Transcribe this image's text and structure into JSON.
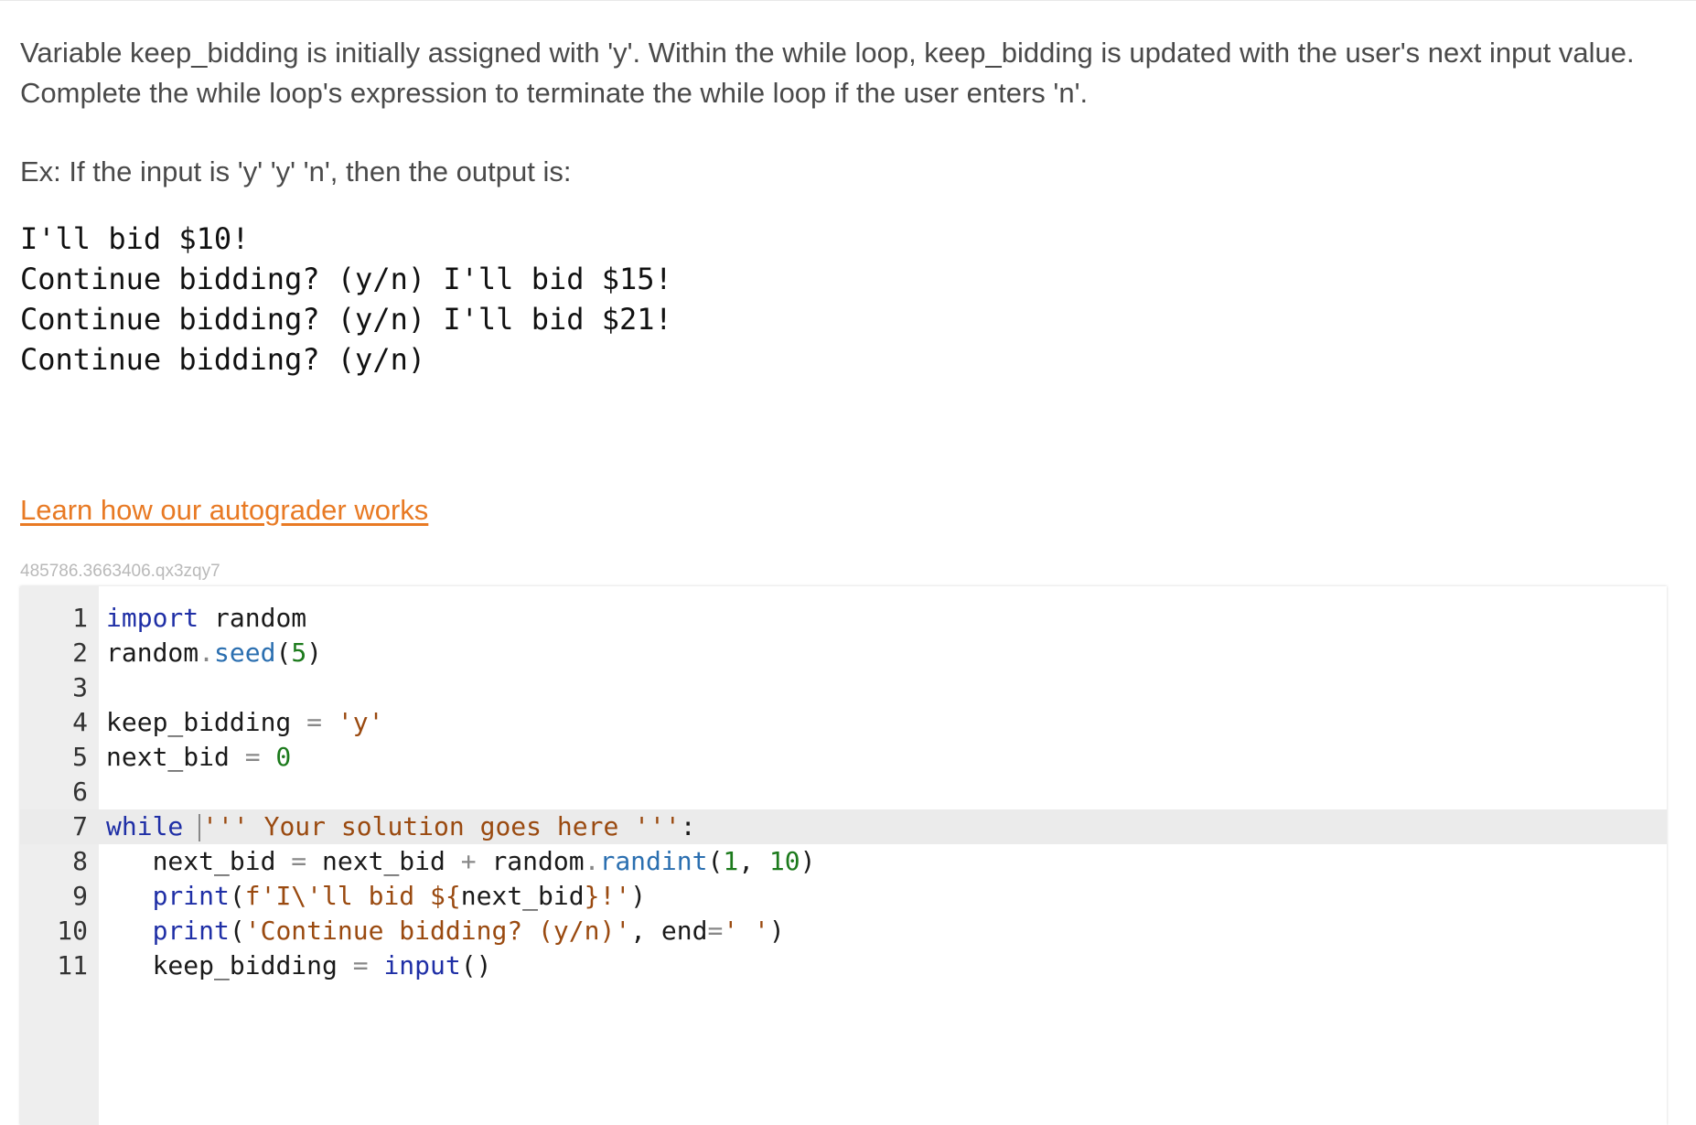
{
  "prompt": {
    "line1": "Variable keep_bidding is initially assigned with 'y'. Within the while loop, keep_bidding is updated with the user's next input value.",
    "line2": "Complete the while loop's expression to terminate the while loop if the user enters 'n'."
  },
  "example": {
    "label": "Ex: If the input is 'y' 'y' 'n', then the output is:",
    "output_lines": [
      "I'll bid $10!",
      "Continue bidding? (y/n) I'll bid $15!",
      "Continue bidding? (y/n) I'll bid $21!",
      "Continue bidding? (y/n)"
    ]
  },
  "link": {
    "text": "Learn how our autograder works"
  },
  "activity_id": "485786.3663406.qx3zqy7",
  "editor": {
    "line_numbers": [
      "1",
      "2",
      "3",
      "4",
      "5",
      "6",
      "7",
      "8",
      "9",
      "10",
      "11"
    ],
    "active_line": 7,
    "tokens": {
      "l1_kw": "import",
      "l1_rest": " random",
      "l2_obj": "random",
      "l2_dot": ".",
      "l2_fn": "seed",
      "l2_open": "(",
      "l2_num": "5",
      "l2_close": ")",
      "l4_var": "keep_bidding ",
      "l4_op": "=",
      "l4_str": " 'y'",
      "l5_var": "next_bid ",
      "l5_op": "=",
      "l5_num": " 0",
      "l7_kw": "while",
      "l7_str": "''' Your solution goes here '''",
      "l7_colon": ":",
      "l8_indent": "   ",
      "l8_var": "next_bid ",
      "l8_op1": "=",
      "l8_mid": " next_bid ",
      "l8_op2": "+",
      "l8_obj": " random",
      "l8_dot": ".",
      "l8_fn": "randint",
      "l8_open": "(",
      "l8_num1": "1",
      "l8_comma": ", ",
      "l8_num2": "10",
      "l8_close": ")",
      "l9_indent": "   ",
      "l9_fn": "print",
      "l9_open": "(",
      "l9_str1": "f'I\\'ll bid $",
      "l9_brace_open": "{",
      "l9_var": "next_bid",
      "l9_brace_close": "}",
      "l9_str2": "!'",
      "l9_close": ")",
      "l10_indent": "   ",
      "l10_fn": "print",
      "l10_open": "(",
      "l10_str1": "'Continue bidding? (y/n)'",
      "l10_comma": ", ",
      "l10_kw": "end",
      "l10_op": "=",
      "l10_str2": "' '",
      "l10_close": ")",
      "l11_indent": "   ",
      "l11_var": "keep_bidding ",
      "l11_op": "=",
      "l11_fn": " input",
      "l11_parens": "()"
    }
  }
}
